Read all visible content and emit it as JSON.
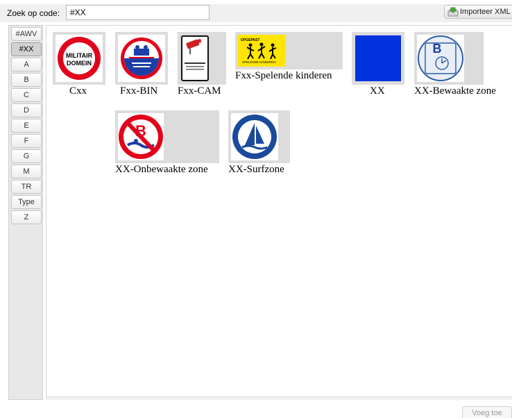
{
  "search": {
    "label": "Zoek op code:",
    "value": "#XX"
  },
  "toolbar": {
    "import_label": "Importeer XML"
  },
  "tabs": [
    "#AWV",
    "#XX",
    "A",
    "B",
    "C",
    "D",
    "E",
    "F",
    "G",
    "M",
    "TR",
    "Type",
    "Z"
  ],
  "active_tab": "#XX",
  "items": [
    {
      "code": "Cxx",
      "sign_text_1": "MILITAIR",
      "sign_text_2": "DOMEIN"
    },
    {
      "code": "Fxx-BIN"
    },
    {
      "code": "Fxx-CAM"
    },
    {
      "code": "Fxx-Spelende kinderen",
      "sign_text_1": "OPGEPAST",
      "sign_text_2": "SPELENDE KINDEREN"
    },
    {
      "code": "XX"
    },
    {
      "code": "XX-Bewaakte zone",
      "sign_letter": "B"
    },
    {
      "code": "XX-Onbewaakte zone",
      "sign_letter": "B"
    },
    {
      "code": "XX-Surfzone"
    }
  ],
  "footer": {
    "add_label": "Voeg toe"
  },
  "colors": {
    "sign_red": "#e3001b",
    "sign_blue": "#0033dd",
    "sign_yellow": "#ffe500",
    "thumb_bg": "#dcdcdc"
  }
}
